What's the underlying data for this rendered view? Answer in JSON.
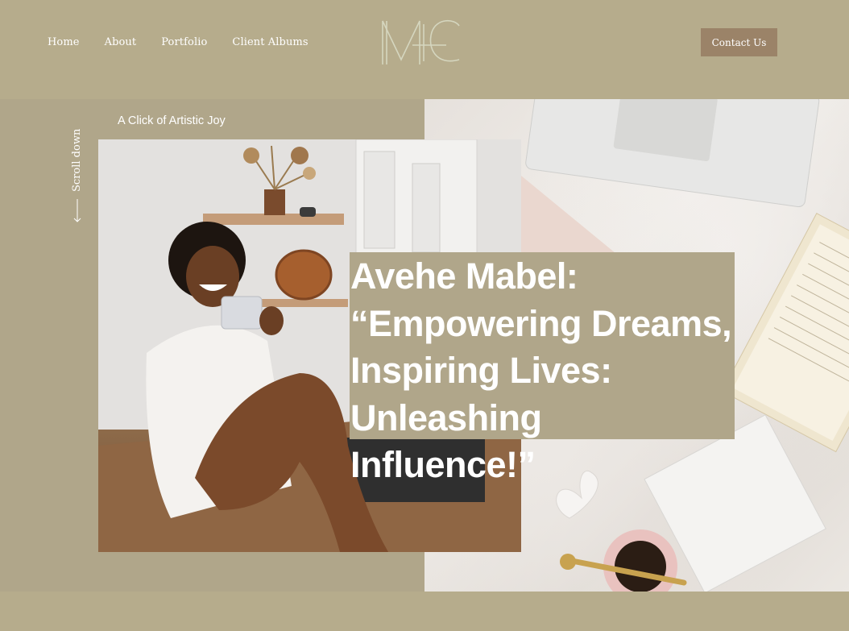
{
  "nav": {
    "items": [
      {
        "label": "Home"
      },
      {
        "label": "About"
      },
      {
        "label": "Portfolio"
      },
      {
        "label": "Client Albums"
      }
    ]
  },
  "logo": {
    "text": "MC"
  },
  "contact": {
    "label": "Contact Us"
  },
  "hero": {
    "eyebrow": "A Click of Artistic Joy",
    "scroll_label": "Scroll down",
    "headline_lines": [
      "Avehe Mabel:",
      "“Empowering Dreams,",
      "Inspiring Lives:",
      "Unleashing Influence!”"
    ]
  },
  "colors": {
    "background": "#b6ac8c",
    "hero_panel": "#b0a68a",
    "button": "#9b8368",
    "text": "#ffffff"
  }
}
